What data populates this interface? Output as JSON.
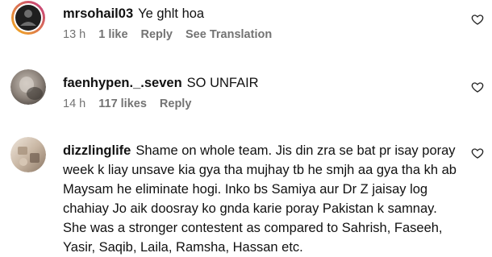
{
  "comments": [
    {
      "username": "mrsohail03",
      "text": "Ye ghlt hoa",
      "time": "13 h",
      "likes": "1 like",
      "reply": "Reply",
      "translate": "See Translation",
      "avatar_icon": "user-avatar-dark-ring"
    },
    {
      "username": "faenhypen._.seven",
      "text": "SO UNFAIR",
      "time": "14 h",
      "likes": "117 likes",
      "reply": "Reply",
      "avatar_icon": "user-avatar-blurred-photo"
    },
    {
      "username": "dizzlinglife",
      "text": "Shame on whole team. Jis din zra se bat pr isay poray week k liay unsave kia gya tha mujhay tb he smjh aa gya tha kh ab Maysam he eliminate hogi. Inko bs Samiya aur Dr Z jaisay log chahiay Jo aik doosray ko gnda karie poray Pakistan k samnay. She was a stronger contestent as compared to Sahrish, Faseeh, Yasir, Saqib, Laila, Ramsha, Hassan etc.",
      "avatar_icon": "user-avatar-beige-photo"
    }
  ],
  "icons": {
    "like": "heart-outline-icon"
  },
  "colors": {
    "text": "#111111",
    "meta": "#737373",
    "avatar_ring_start": "#c13584",
    "avatar_ring_end": "#f5b21b"
  }
}
